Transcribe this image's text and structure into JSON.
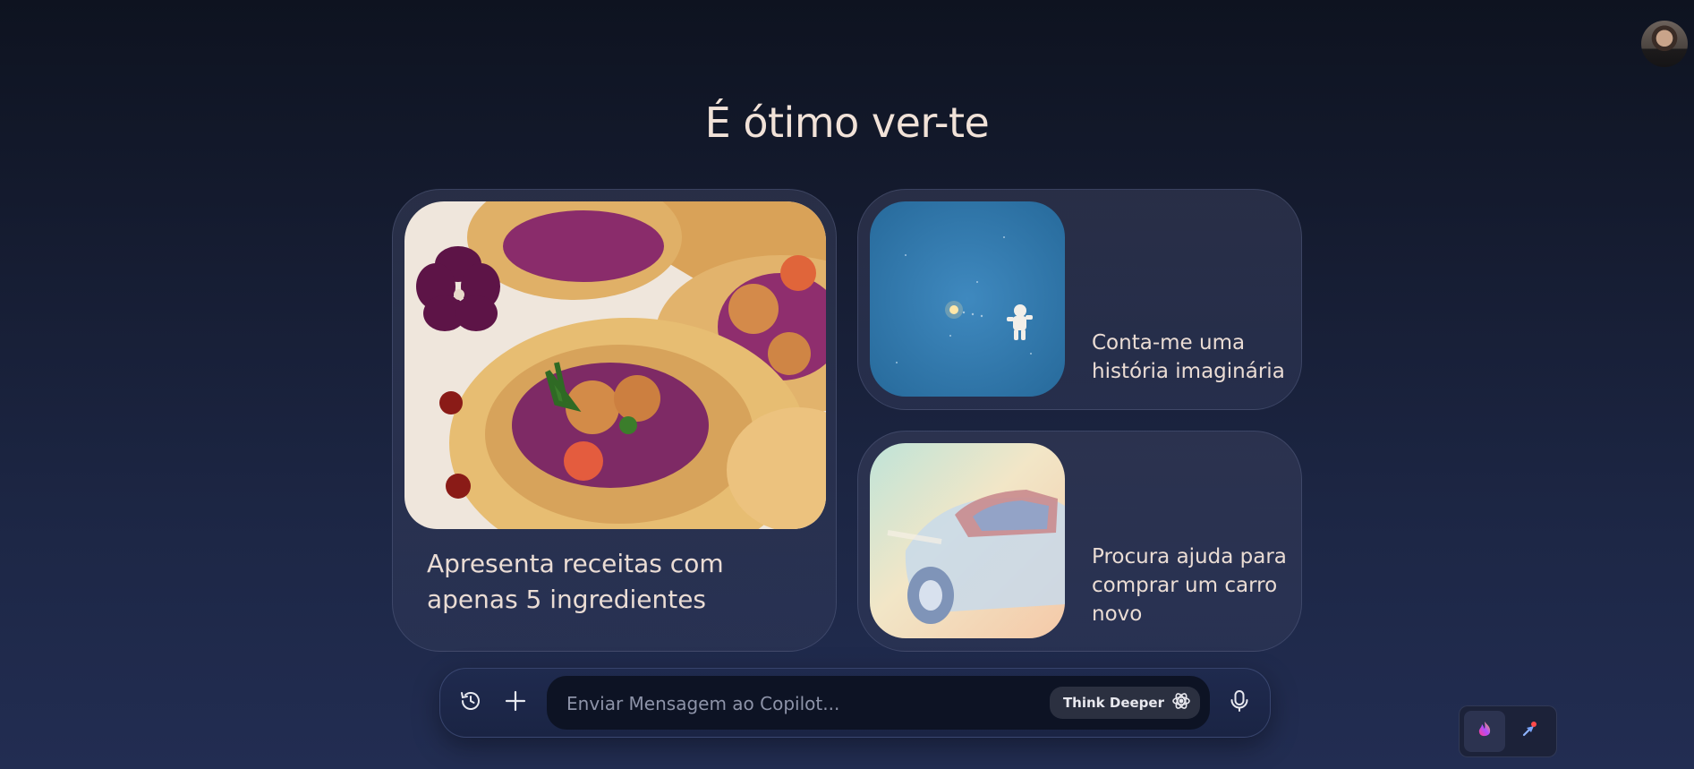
{
  "header": {
    "greeting": "É ótimo ver-te",
    "avatar_icon": "user-avatar"
  },
  "suggestions": [
    {
      "label": "Apresenta receitas com apenas 5 ingredientes",
      "image": "tacos-photo"
    },
    {
      "label": "Conta-me uma história imaginária",
      "image": "astronaut-in-space"
    },
    {
      "label": "Procura ajuda para comprar um carro novo",
      "image": "pastel-car-painting"
    }
  ],
  "composer": {
    "placeholder": "Enviar Mensagem ao Copilot...",
    "value": "",
    "think_deeper_label": "Think Deeper",
    "icons": {
      "history": "history-clock-icon",
      "add": "plus-icon",
      "think": "atom-icon",
      "mic": "microphone-icon"
    }
  },
  "extensions": {
    "icons": [
      "copilot-flame-icon",
      "extension-pin-icon"
    ]
  },
  "colors": {
    "background_top": "#0e1320",
    "background_bottom": "#222d52",
    "greeting_text": "#f1e2d8",
    "card_text": "#eadcd4",
    "input_background": "#0d1324"
  }
}
